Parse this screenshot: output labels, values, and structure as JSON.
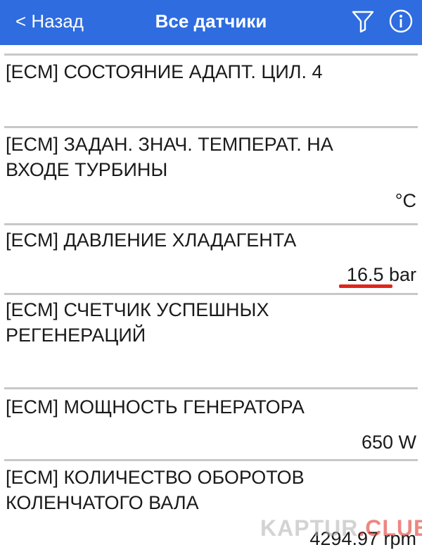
{
  "header": {
    "back_label": "< Назад",
    "title": "Все датчики",
    "filter_icon": "filter-icon",
    "info_icon": "info-icon",
    "background_color": "#2e6cdf"
  },
  "sensors": [
    {
      "name": "[ECM] СОСТОЯНИЕ АДАПТ. ЦИЛ. 4",
      "value": ""
    },
    {
      "name": "[ECM] ЗАДАН. ЗНАЧ. ТЕМПЕРАТ. НА ВХОДЕ ТУРБИНЫ",
      "value": "°C"
    },
    {
      "name": "[ECM] ДАВЛЕНИЕ ХЛАДАГЕНТА",
      "value": "16.5 bar"
    },
    {
      "name": "[ECM] СЧЕТЧИК УСПЕШНЫХ РЕГЕНЕРАЦИЙ",
      "value": ""
    },
    {
      "name": "[ECM] МОЩНОСТЬ ГЕНЕРАТОРА",
      "value": "650 W"
    },
    {
      "name": "[ECM] КОЛИЧЕСТВО ОБОРОТОВ КОЛЕНЧАТОГО ВАЛА",
      "value": "4294.97 rpm"
    }
  ],
  "annotation": {
    "color": "#e0261b"
  },
  "watermark": {
    "part1": "KAPTUR",
    "part2": ".CLUB"
  }
}
